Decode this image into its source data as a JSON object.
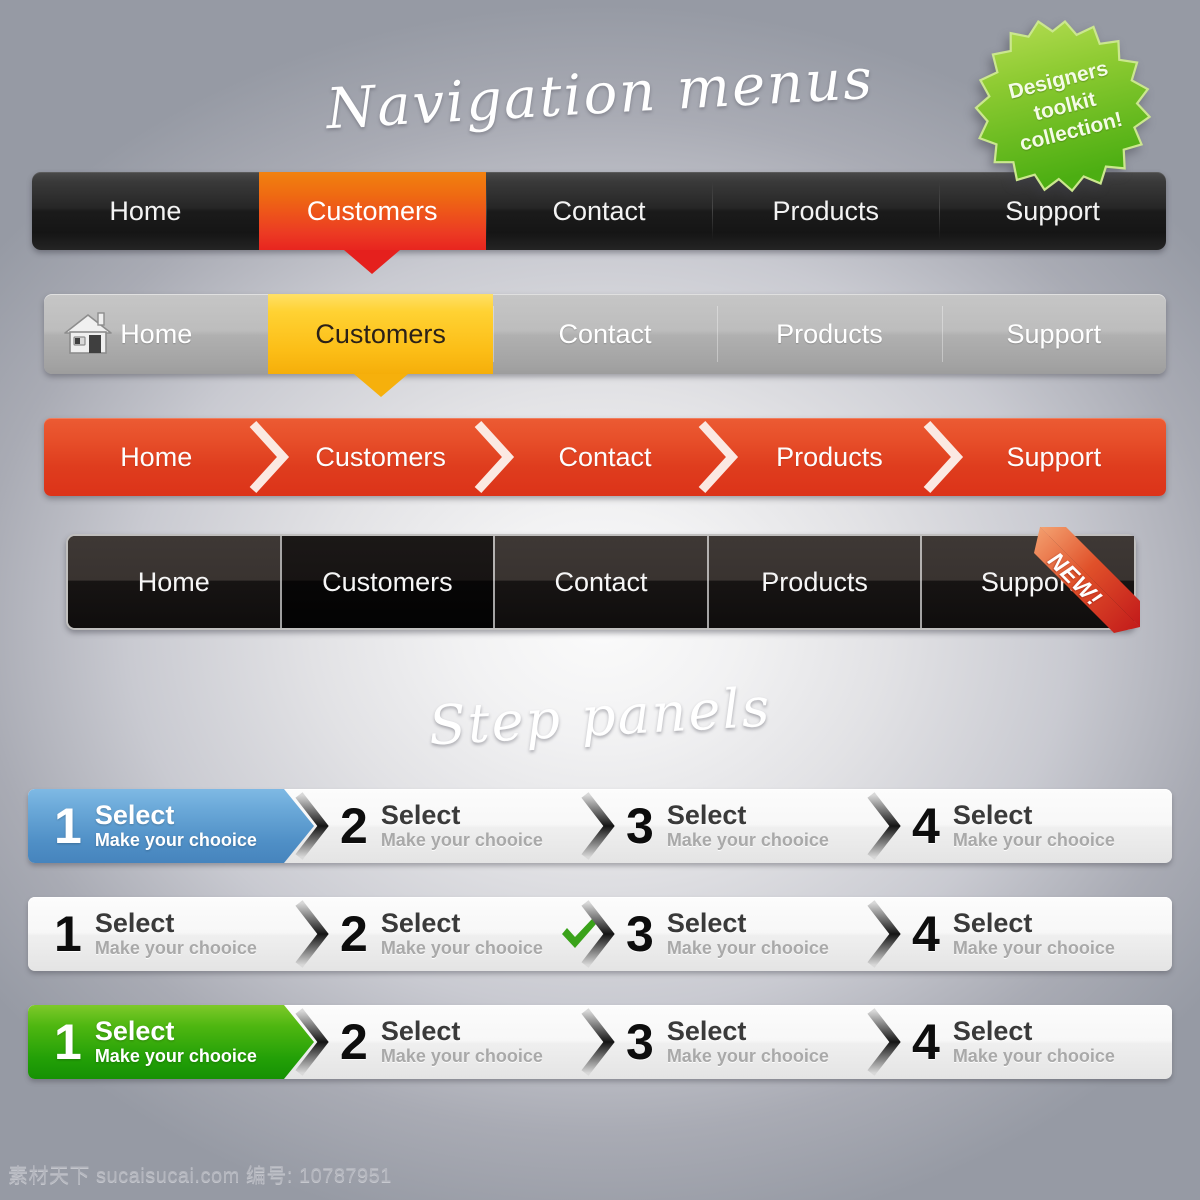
{
  "page": {
    "background_color": "#9a9ca6",
    "watermark": "素材天下 sucaisucai.com 编号: 10787951"
  },
  "sections": {
    "nav_title": "Navigation menus",
    "step_title": "Step panels"
  },
  "badge": {
    "line1": "Designers",
    "line2": "toolkit",
    "line3": "collection!",
    "fill_top": "#9ed33c",
    "fill_bottom": "#4fb014",
    "text_color": "#f4fbe6"
  },
  "nav_bars": [
    {
      "id": "nav1",
      "style": "dark-glossy",
      "active_index": 1,
      "active_color": "#ec3b23",
      "items": [
        {
          "label": "Home"
        },
        {
          "label": "Customers"
        },
        {
          "label": "Contact"
        },
        {
          "label": "Products"
        },
        {
          "label": "Support"
        }
      ]
    },
    {
      "id": "nav2",
      "style": "light-gray-with-home-icon",
      "active_index": 1,
      "active_color": "#fcbe17",
      "home_icon": "house-icon",
      "items": [
        {
          "label": "Home"
        },
        {
          "label": "Customers"
        },
        {
          "label": "Contact"
        },
        {
          "label": "Products"
        },
        {
          "label": "Support"
        }
      ]
    },
    {
      "id": "nav3",
      "style": "orange-breadcrumb-chevrons",
      "active_index": -1,
      "base_color": "#e74f2a",
      "separator_icon": "chevron-right-icon",
      "items": [
        {
          "label": "Home"
        },
        {
          "label": "Customers"
        },
        {
          "label": "Contact"
        },
        {
          "label": "Products"
        },
        {
          "label": "Support"
        }
      ]
    },
    {
      "id": "nav4",
      "style": "segmented-dark-framed",
      "active_index": 1,
      "ribbon_label": "NEW!",
      "ribbon_color": "#d8331c",
      "items": [
        {
          "label": "Home"
        },
        {
          "label": "Customers"
        },
        {
          "label": "Contact"
        },
        {
          "label": "Products"
        },
        {
          "label": "Support"
        }
      ]
    }
  ],
  "step_rows": [
    {
      "id": "steps1",
      "active_index": 0,
      "active_color": "#4f8fc6",
      "active_variant": "blue",
      "checked_index": -1,
      "steps": [
        {
          "number": "1",
          "title": "Select",
          "subtitle": "Make your chooice"
        },
        {
          "number": "2",
          "title": "Select",
          "subtitle": "Make your chooice"
        },
        {
          "number": "3",
          "title": "Select",
          "subtitle": "Make your chooice"
        },
        {
          "number": "4",
          "title": "Select",
          "subtitle": "Make your chooice"
        }
      ]
    },
    {
      "id": "steps2",
      "active_index": -1,
      "active_color": "",
      "active_variant": "",
      "checked_index": 1,
      "check_color": "#3aa21a",
      "steps": [
        {
          "number": "1",
          "title": "Select",
          "subtitle": "Make your chooice"
        },
        {
          "number": "2",
          "title": "Select",
          "subtitle": "Make your chooice"
        },
        {
          "number": "3",
          "title": "Select",
          "subtitle": "Make your chooice"
        },
        {
          "number": "4",
          "title": "Select",
          "subtitle": "Make your chooice"
        }
      ]
    },
    {
      "id": "steps3",
      "active_index": 0,
      "active_color": "#23a007",
      "active_variant": "green",
      "checked_index": -1,
      "steps": [
        {
          "number": "1",
          "title": "Select",
          "subtitle": "Make your chooice"
        },
        {
          "number": "2",
          "title": "Select",
          "subtitle": "Make your chooice"
        },
        {
          "number": "3",
          "title": "Select",
          "subtitle": "Make your chooice"
        },
        {
          "number": "4",
          "title": "Select",
          "subtitle": "Make your chooice"
        }
      ]
    }
  ]
}
